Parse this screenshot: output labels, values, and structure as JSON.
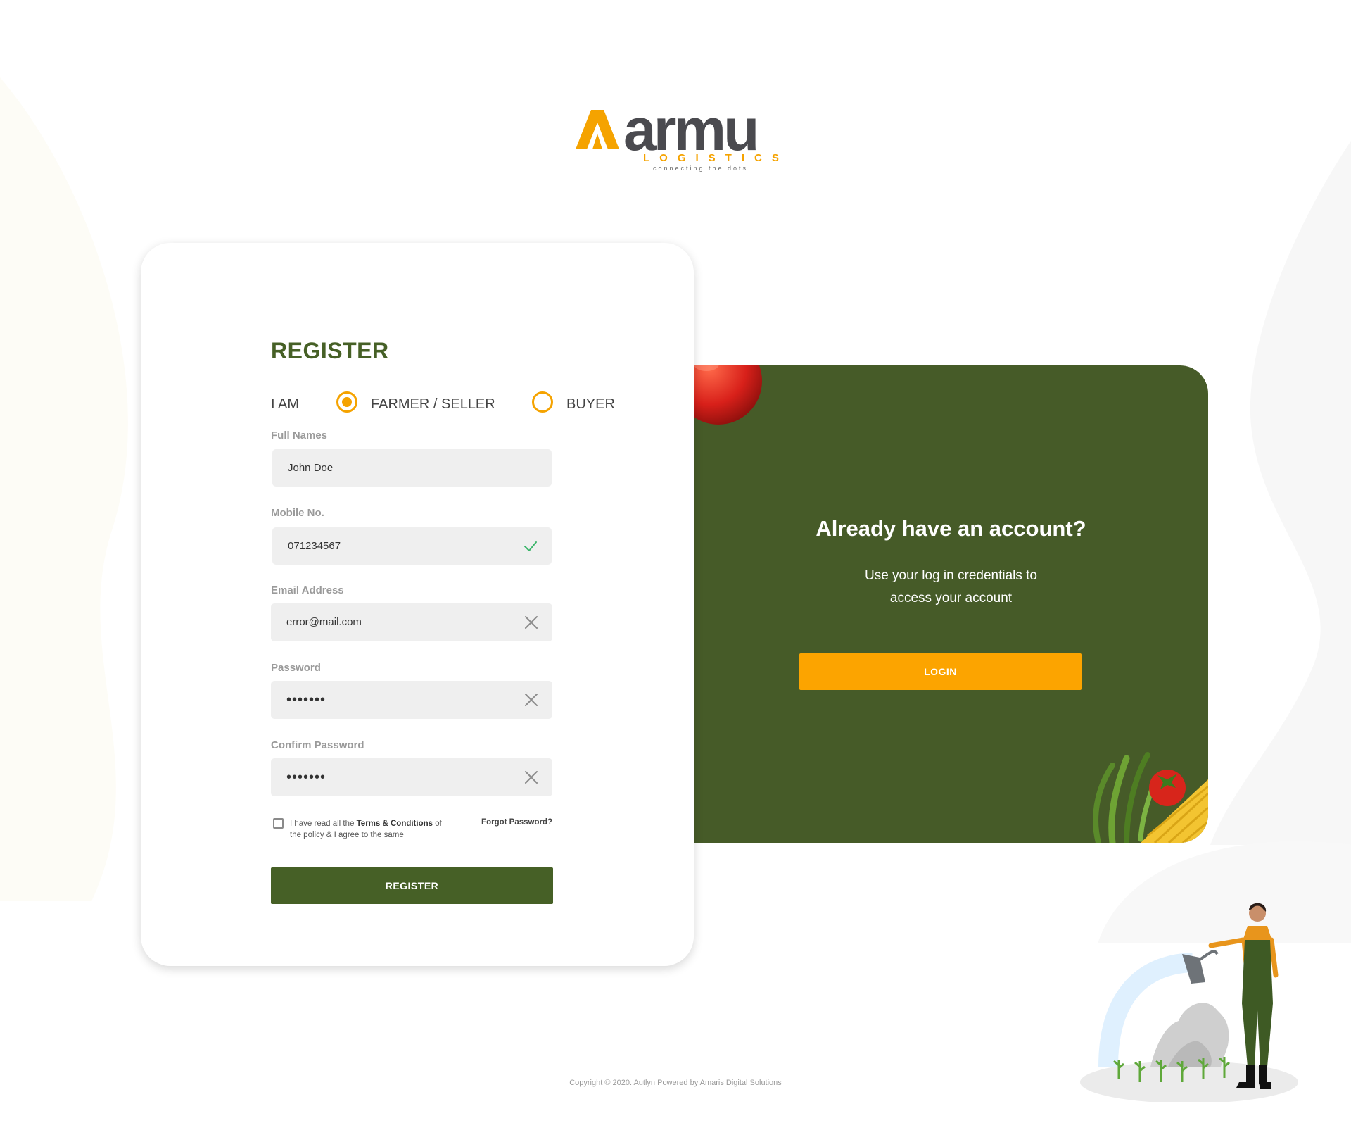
{
  "brand": {
    "logo_word": "armu",
    "logo_sub": "LOGISTICS",
    "logo_tagline": "connecting the dots",
    "accent_color": "#f5a300",
    "primary_color": "#466026"
  },
  "register": {
    "title": "REGISTER",
    "role_label": "I AM",
    "roles": [
      {
        "label": "FARMER / SELLER",
        "selected": true
      },
      {
        "label": "BUYER",
        "selected": false
      }
    ],
    "fields": {
      "full_names": {
        "label": "Full Names",
        "value": "John Doe",
        "status": "none"
      },
      "mobile": {
        "label": "Mobile No.",
        "value": "071234567",
        "status": "valid",
        "icon": "check-icon"
      },
      "email": {
        "label": "Email Address",
        "value": "error@mail.com",
        "status": "error",
        "icon": "close-icon"
      },
      "password": {
        "label": "Password",
        "value": "•••••••",
        "status": "clearable",
        "icon": "close-icon"
      },
      "confirm_password": {
        "label": "Confirm Password",
        "value": "•••••••",
        "status": "clearable",
        "icon": "close-icon"
      }
    },
    "terms": {
      "text_before": "I have read all the ",
      "link": "Terms & Conditions",
      "text_after": " of the policy & I agree to the same",
      "checked": false
    },
    "forgot_password": "Forgot Password?",
    "button": "REGISTER"
  },
  "login": {
    "heading": "Already have an account?",
    "sub_line1": "Use your log in credentials to",
    "sub_line2": "access your account",
    "button": "LOGIN"
  },
  "footer": {
    "copyright": "Copyright © 2020. Autlyn Powered by Amaris Digital Solutions"
  }
}
